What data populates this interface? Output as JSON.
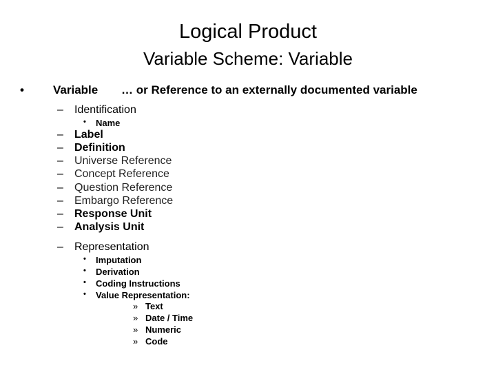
{
  "slide": {
    "title": "Logical Product",
    "subtitle": "Variable Scheme: Variable",
    "main_bullet": {
      "marker": "•",
      "label": "Variable",
      "note": "… or Reference to an externally documented variable"
    },
    "identification": {
      "marker": "–",
      "label": "Identification",
      "children": [
        {
          "marker": "•",
          "label": "Name"
        }
      ]
    },
    "items": [
      {
        "marker": "–",
        "label": "Label"
      },
      {
        "marker": "–",
        "label": "Definition"
      },
      {
        "marker": "–",
        "label": "Universe Reference"
      },
      {
        "marker": "–",
        "label": "Concept Reference"
      },
      {
        "marker": "–",
        "label": "Question Reference"
      },
      {
        "marker": "–",
        "label": "Embargo Reference"
      },
      {
        "marker": "–",
        "label": "Response Unit"
      },
      {
        "marker": "–",
        "label": "Analysis Unit"
      }
    ],
    "representation": {
      "marker": "–",
      "label": "Representation",
      "children": [
        {
          "marker": "•",
          "label": "Imputation"
        },
        {
          "marker": "•",
          "label": "Derivation"
        },
        {
          "marker": "•",
          "label": "Coding Instructions"
        },
        {
          "marker": "•",
          "label": "Value Representation:"
        }
      ],
      "value_types": [
        {
          "marker": "»",
          "label": "Text"
        },
        {
          "marker": "»",
          "label": "Date / Time"
        },
        {
          "marker": "»",
          "label": "Numeric"
        },
        {
          "marker": "»",
          "label": "Code"
        }
      ]
    }
  }
}
